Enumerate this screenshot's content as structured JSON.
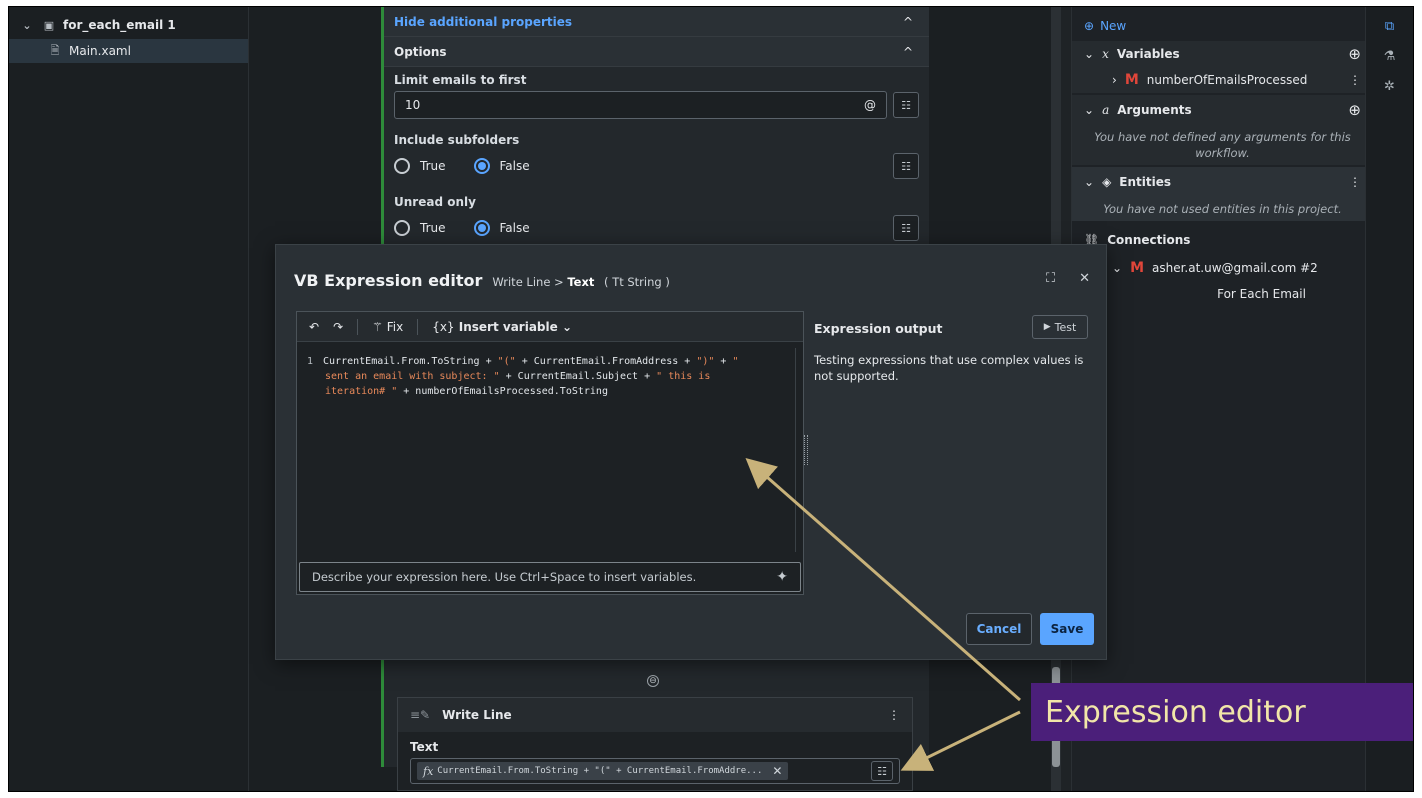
{
  "tree": {
    "project": "for_each_email 1",
    "file": "Main.xaml"
  },
  "props": {
    "hide_link": "Hide additional properties",
    "options": "Options",
    "limit_label": "Limit emails to first",
    "limit_value": "10",
    "at_symbol": "@",
    "subfolders_label": "Include subfolders",
    "unread_label": "Unread only",
    "true_label": "True",
    "false_label": "False"
  },
  "write_line": {
    "title": "Write Line",
    "text_label": "Text",
    "chip_text": "CurrentEmail.From.ToString + \"(\" + CurrentEmail.FromAddre...",
    "fx": "fx"
  },
  "right_panel": {
    "new": "New",
    "variables": "Variables",
    "variable_item": "numberOfEmailsProcessed",
    "arguments": "Arguments",
    "arguments_empty": "You have not defined any arguments for this workflow.",
    "entities": "Entities",
    "entities_empty": "You have not used entities in this project.",
    "connections": "Connections",
    "connection_item": "asher.at.uw@gmail.com #2",
    "connection_sub": "For Each Email"
  },
  "modal": {
    "title": "VB Expression editor",
    "crumb_parent": "Write Line",
    "crumb_sep": ">",
    "crumb_current": "Text",
    "type_hint": "( Tt String )",
    "toolbar": {
      "fix": "Fix",
      "insert_variable": "Insert variable"
    },
    "code_line_number": "1",
    "code": {
      "a": "CurrentEmail.From.ToString + ",
      "s1": "\"(\"",
      "b": " + CurrentEmail.FromAddress + ",
      "s2": "\")\"",
      "c": " + ",
      "s3": "\"",
      "s3b": "sent an email with subject: \"",
      "d": " + CurrentEmail.Subject + ",
      "s4": "\" this is",
      "s4b": "iteration# \"",
      "e": " + numberOfEmailsProcessed.ToString"
    },
    "describe_placeholder": "Describe your expression here. Use Ctrl+Space to insert variables.",
    "output_title": "Expression output",
    "test": "Test",
    "output_text": "Testing expressions that use complex values is not supported.",
    "cancel": "Cancel",
    "save": "Save"
  },
  "annotation": {
    "label": "Expression editor",
    "color": "#4b1f7a",
    "text_color": "#f1e6a8",
    "arrow_color": "#c8b27a"
  },
  "colors": {
    "accent": "#5aa5ff",
    "string": "#e8895a",
    "gmail": "#e0463a",
    "active_border": "#2e8b3a"
  }
}
